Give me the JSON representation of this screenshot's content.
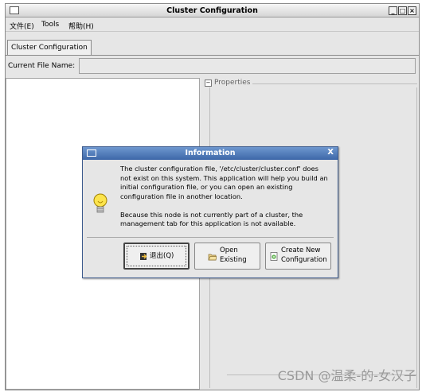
{
  "window": {
    "title": "Cluster Configuration"
  },
  "menubar": {
    "items": [
      "文件(E)",
      "Tools",
      "帮助(H)"
    ]
  },
  "tabs": [
    "Cluster Configuration"
  ],
  "file_row": {
    "label": "Current File Name:",
    "value": ""
  },
  "properties": {
    "label": "Properties"
  },
  "dialog": {
    "title": "Information",
    "close_glyph": "X",
    "message_lines": [
      "The cluster configuration file, '/etc/cluster/cluster.conf' does",
      "not exist on this system. This application will help you build an",
      "initial configuration file, or you can open an existing",
      "configuration file in another location.",
      "",
      "Because this node is not currently part of a cluster, the",
      "management tab for this application is not available."
    ],
    "buttons": {
      "quit": "退出(Q)",
      "open_line1": "Open",
      "open_line2": "Existing",
      "create_line1": "Create New",
      "create_line2": "Configuration"
    }
  },
  "watermark": "CSDN @温柔-的-女汉子",
  "colors": {
    "dialog_title": "#4a73b3",
    "window_bg": "#e6e6e6"
  }
}
